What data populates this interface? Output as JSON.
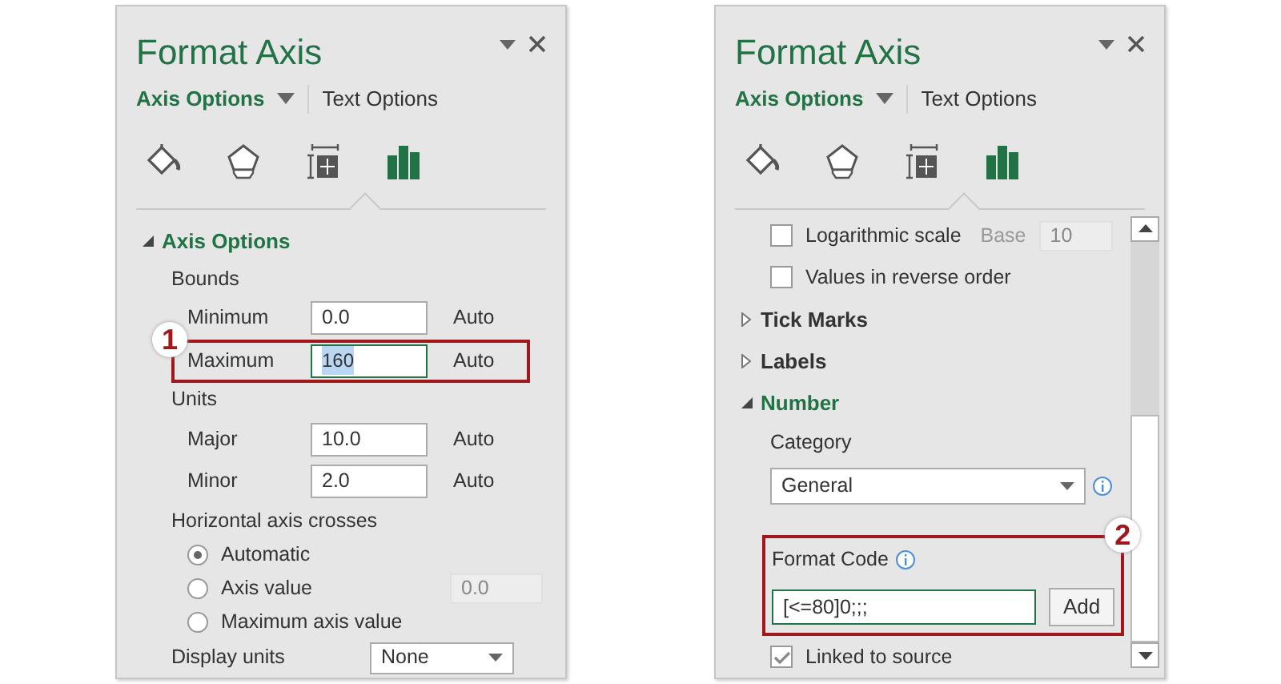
{
  "panels": [
    {
      "title": "Format Axis",
      "tabs": [
        {
          "label": "Axis Options",
          "selected": true
        },
        {
          "label": "Text Options",
          "selected": false
        }
      ],
      "icon_tabs": [
        {
          "kind": "fill",
          "selected": false
        },
        {
          "kind": "effects",
          "selected": false
        },
        {
          "kind": "size",
          "selected": false
        },
        {
          "kind": "axis",
          "selected": true
        }
      ],
      "scrollbar": false,
      "items": [
        {
          "kind": "section",
          "label": "Axis Options",
          "expanded": true
        },
        {
          "kind": "heading",
          "label": "Bounds"
        },
        {
          "kind": "field",
          "label": "Minimum",
          "value": "0.0",
          "suffix": "Auto",
          "focused": false
        },
        {
          "kind": "field",
          "label": "Maximum",
          "value": "160",
          "suffix": "Auto",
          "focused": true,
          "callout": "1"
        },
        {
          "kind": "heading",
          "label": "Units"
        },
        {
          "kind": "field",
          "label": "Major",
          "value": "10.0",
          "suffix": "Auto",
          "focused": false
        },
        {
          "kind": "field",
          "label": "Minor",
          "value": "2.0",
          "suffix": "Auto",
          "focused": false
        },
        {
          "kind": "heading",
          "label": "Horizontal axis crosses"
        },
        {
          "kind": "radio",
          "label": "Automatic",
          "selected": true
        },
        {
          "kind": "radio",
          "label": "Axis value",
          "selected": false,
          "value": "0.0"
        },
        {
          "kind": "radio",
          "label": "Maximum axis value",
          "selected": false
        },
        {
          "kind": "select",
          "label": "Display units",
          "value": "None"
        }
      ]
    },
    {
      "title": "Format Axis",
      "tabs": [
        {
          "label": "Axis Options",
          "selected": true
        },
        {
          "label": "Text Options",
          "selected": false
        }
      ],
      "icon_tabs": [
        {
          "kind": "fill",
          "selected": false
        },
        {
          "kind": "effects",
          "selected": false
        },
        {
          "kind": "size",
          "selected": false
        },
        {
          "kind": "axis",
          "selected": true
        }
      ],
      "scrollbar": true,
      "items": [
        {
          "kind": "checkbox",
          "label": "Logarithmic scale",
          "checked": false,
          "extra_label": "Base",
          "value": "10"
        },
        {
          "kind": "checkbox",
          "label": "Values in reverse order",
          "checked": false
        },
        {
          "kind": "section",
          "label": "Tick Marks",
          "expanded": false
        },
        {
          "kind": "section",
          "label": "Labels",
          "expanded": false
        },
        {
          "kind": "section",
          "label": "Number",
          "expanded": true
        },
        {
          "kind": "heading",
          "label": "Category"
        },
        {
          "kind": "select",
          "value": "General",
          "info": true
        },
        {
          "kind": "format_code",
          "label": "Format Code",
          "value": "[<=80]0;;;",
          "button": "Add",
          "callout": "2"
        },
        {
          "kind": "checkbox",
          "label": "Linked to source",
          "checked": true
        }
      ]
    }
  ]
}
